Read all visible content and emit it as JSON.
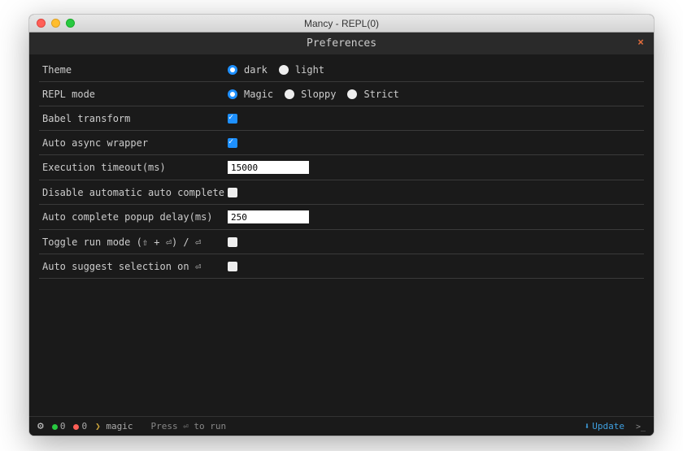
{
  "window": {
    "title": "Mancy - REPL(0)"
  },
  "prefs": {
    "header": "Preferences",
    "rows": {
      "theme": {
        "label": "Theme",
        "options": [
          "dark",
          "light"
        ],
        "selected": "dark"
      },
      "repl": {
        "label": "REPL mode",
        "options": [
          "Magic",
          "Sloppy",
          "Strict"
        ],
        "selected": "Magic"
      },
      "babel": {
        "label": "Babel transform",
        "checked": true
      },
      "asyncw": {
        "label": "Auto async wrapper",
        "checked": true
      },
      "timeout": {
        "label": "Execution timeout(ms)",
        "value": "15000"
      },
      "noauto": {
        "label": "Disable automatic auto complete",
        "checked": false
      },
      "popup": {
        "label": "Auto complete popup delay(ms)",
        "value": "250"
      },
      "toggle": {
        "label": "Toggle run mode (⇧ + ⏎) / ⏎",
        "checked": false
      },
      "suggest": {
        "label": "Auto suggest selection on ⏎",
        "checked": false
      }
    }
  },
  "status": {
    "green_count": "0",
    "red_count": "0",
    "tag_icon": "❯",
    "mode": "magic",
    "hint": "Press ⏎ to run",
    "update": "Update"
  }
}
